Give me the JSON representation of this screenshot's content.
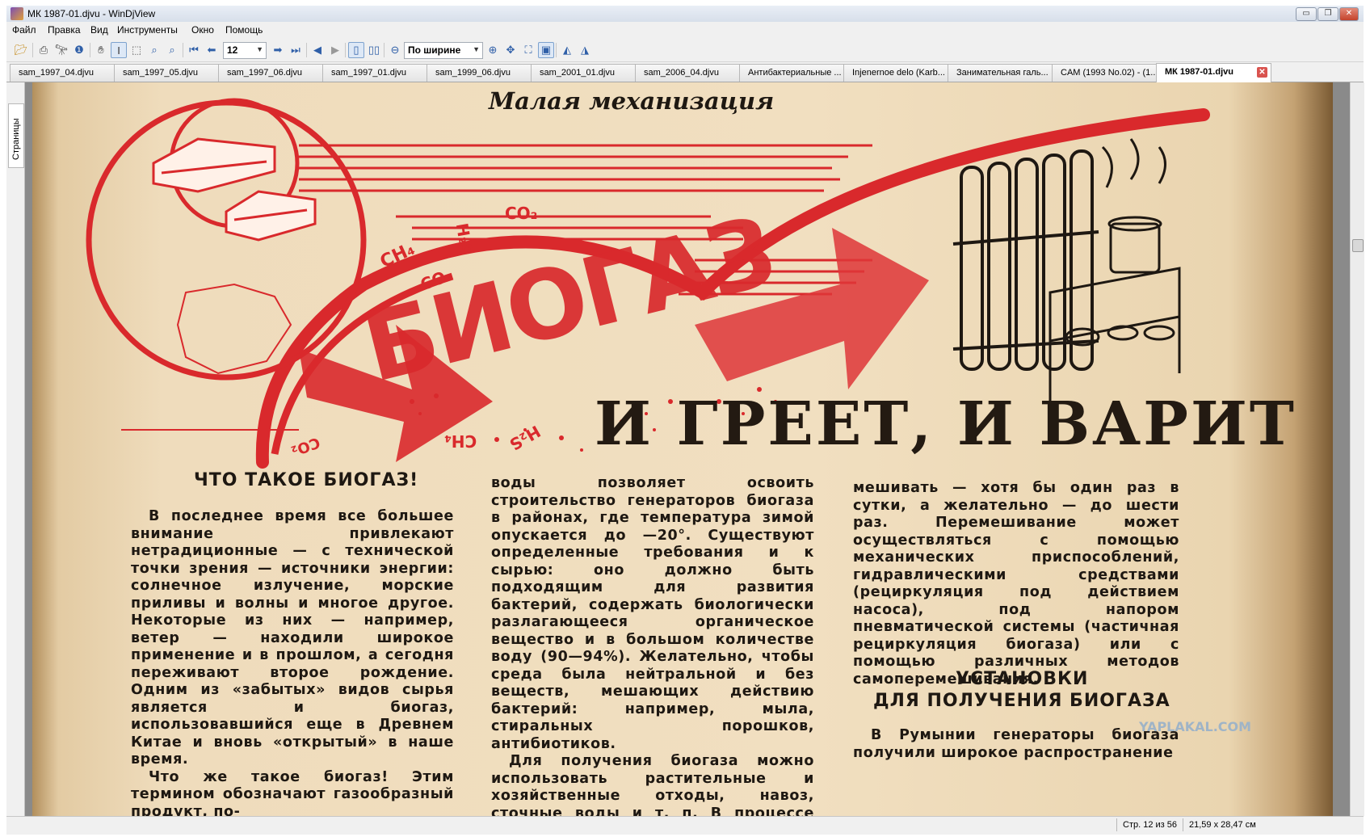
{
  "window": {
    "title": "МК 1987-01.djvu - WinDjView",
    "buttons": {
      "minimize": "▭",
      "maximize": "❐",
      "close": "✕"
    }
  },
  "menu": [
    "Файл",
    "Правка",
    "Вид",
    "Инструменты",
    "Окно",
    "Помощь"
  ],
  "toolbar": {
    "page_value": "12",
    "zoom_value": "По ширине",
    "icons": [
      "open-icon",
      "print-icon",
      "find-icon",
      "info-icon",
      "hand-icon",
      "select-text-icon",
      "select-area-icon",
      "zoom-in-rect-icon",
      "zoom-out-rect-icon",
      "first-page-icon",
      "prev-page-icon",
      "next-page-icon",
      "last-page-icon",
      "back-icon",
      "forward-icon",
      "single-page-icon",
      "two-page-icon",
      "zoom-out-icon",
      "zoom-in-icon",
      "fit-width-icon",
      "fit-page-icon",
      "actual-size-icon",
      "rotate-left-icon",
      "rotate-right-icon"
    ]
  },
  "tabs": [
    {
      "label": "sam_1997_04.djvu"
    },
    {
      "label": "sam_1997_05.djvu"
    },
    {
      "label": "sam_1997_06.djvu"
    },
    {
      "label": "sam_1997_01.djvu"
    },
    {
      "label": "sam_1999_06.djvu"
    },
    {
      "label": "sam_2001_01.djvu"
    },
    {
      "label": "sam_2006_04.djvu"
    },
    {
      "label": "Антибактериальные ..."
    },
    {
      "label": "Injenernoe delo (Karb..."
    },
    {
      "label": "Занимательная галь..."
    },
    {
      "label": "CAM (1993 No.02) - (1..."
    },
    {
      "label": "МК 1987-01.djvu"
    }
  ],
  "sidebar": {
    "tab_label": "Страницы"
  },
  "status": {
    "page": "Стр. 12 из 56",
    "size": "21,59 x 28,47 см"
  },
  "article": {
    "rubric": "Малая механизация",
    "big_title": "БИОГАЗ",
    "headline": "И ГРЕЕТ, И ВАРИТ",
    "diagram_labels": [
      "CH₄",
      "H₂S",
      "CO₂",
      "CO₂",
      "CH₄",
      "H₂S",
      "CO₂"
    ],
    "section1_title": "ЧТО ТАКОЕ БИОГАЗ!",
    "col1": [
      "В последнее время все большее внимание привлекают нетрадиционные — с технической точки зрения — источники энергии: солнечное излучение, морские приливы и волны и многое другое. Некоторые из них — например, ветер — находили широкое применение и в прошлом, а сегодня переживают второе рождение. Одним из «забытых» видов сырья является и биогаз, использовавшийся еще в Древнем Китае и вновь «открытый» в наше время.",
      "Что же такое биогаз! Этим термином обозначают газообразный продукт, по-"
    ],
    "col2": [
      "воды позволяет освоить строительство генераторов биогаза в районах, где температура зимой опускается до —20°. Существуют определенные требования и к сырью: оно должно быть подходящим для развития бактерий, содержать биологически разлагающееся органическое вещество и в большом количестве воду (90—94%). Желательно, чтобы среда была нейтральной и без веществ, мешающих действию бактерий: например, мыла, стиральных порошков, антибиотиков.",
      "Для получения биогаза можно использовать растительные и хозяйственные отходы, навоз, сточные воды и т. п. В процессе ферментации жид-"
    ],
    "col3": [
      "мешивать — хотя бы один раз в сутки, а желательно — до шести раз. Перемешивание может осуществляться с помощью механических приспособлений, гидравлическими средствами (рециркуляция под действием насоса), под напором пневматической системы (частичная рециркуляция биогаза) или с помощью различных методов самоперемешивания."
    ],
    "section2_title_1": "УСТАНОВКИ",
    "section2_title_2": "ДЛЯ ПОЛУЧЕНИЯ БИОГАЗА",
    "col3_b": "В Румынии генераторы биогаза получили широкое распространение",
    "watermark": "YAPLAKAL.COM",
    "colors": {
      "red": "#d9292c",
      "ink": "#1e1812",
      "paper": "#f1dfc0"
    }
  }
}
